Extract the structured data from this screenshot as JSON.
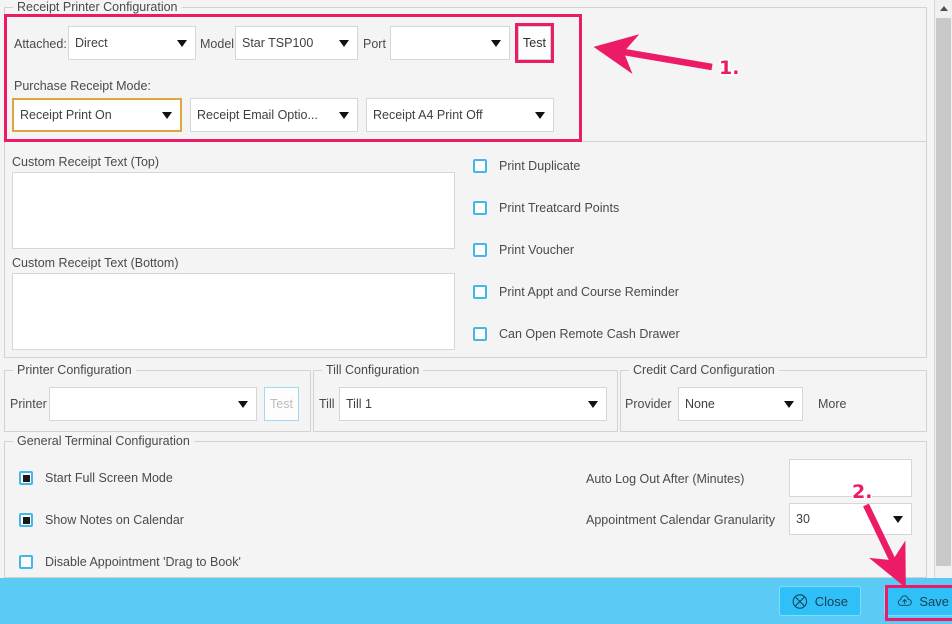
{
  "theme": {
    "accent_pink": "#ec1b68",
    "accent_blue": "#5bcbf5",
    "button_blue": "#2ec0f7",
    "checkbox_blue": "#43b7e8",
    "focus_orange": "#e0a53c",
    "background": "#f4f4f4"
  },
  "receipt_printer": {
    "group_title": "Receipt Printer Configuration",
    "attached_label": "Attached:",
    "attached_value": "Direct",
    "model_label": "Model",
    "model_value": "Star TSP100",
    "port_label": "Port",
    "port_value": "",
    "test_button": "Test",
    "purchase_mode_label": "Purchase Receipt Mode:",
    "mode_print": "Receipt Print On",
    "mode_email": "Receipt Email Optio...",
    "mode_a4": "Receipt A4 Print Off"
  },
  "custom_text": {
    "top_label": "Custom Receipt Text (Top)",
    "top_value": "",
    "bottom_label": "Custom Receipt Text (Bottom)",
    "bottom_value": ""
  },
  "print_options": [
    {
      "label": "Print Duplicate",
      "checked": false
    },
    {
      "label": "Print Treatcard Points",
      "checked": false
    },
    {
      "label": "Print Voucher",
      "checked": false
    },
    {
      "label": "Print Appt and Course Reminder",
      "checked": false
    },
    {
      "label": "Can Open Remote Cash Drawer",
      "checked": false
    }
  ],
  "printer_config": {
    "group_title": "Printer Configuration",
    "printer_label": "Printer",
    "printer_value": "",
    "test_button": "Test"
  },
  "till_config": {
    "group_title": "Till Configuration",
    "till_label": "Till",
    "till_value": "Till 1"
  },
  "credit_card_config": {
    "group_title": "Credit Card Configuration",
    "provider_label": "Provider",
    "provider_value": "None",
    "more_label": "More"
  },
  "general_terminal": {
    "group_title": "General Terminal Configuration",
    "checkboxes": [
      {
        "label": "Start Full Screen Mode",
        "checked": true
      },
      {
        "label": "Show Notes on Calendar",
        "checked": true
      },
      {
        "label": "Disable Appointment 'Drag to Book'",
        "checked": false
      }
    ],
    "auto_logout_label": "Auto Log Out After (Minutes)",
    "auto_logout_value": "",
    "granularity_label": "Appointment Calendar Granularity",
    "granularity_value": "30"
  },
  "footer": {
    "close_label": "Close",
    "close_icon": "circle-x-icon",
    "save_label": "Save",
    "save_icon": "cloud-upload-icon"
  },
  "annotations": {
    "step1": "1.",
    "step2": "2."
  }
}
